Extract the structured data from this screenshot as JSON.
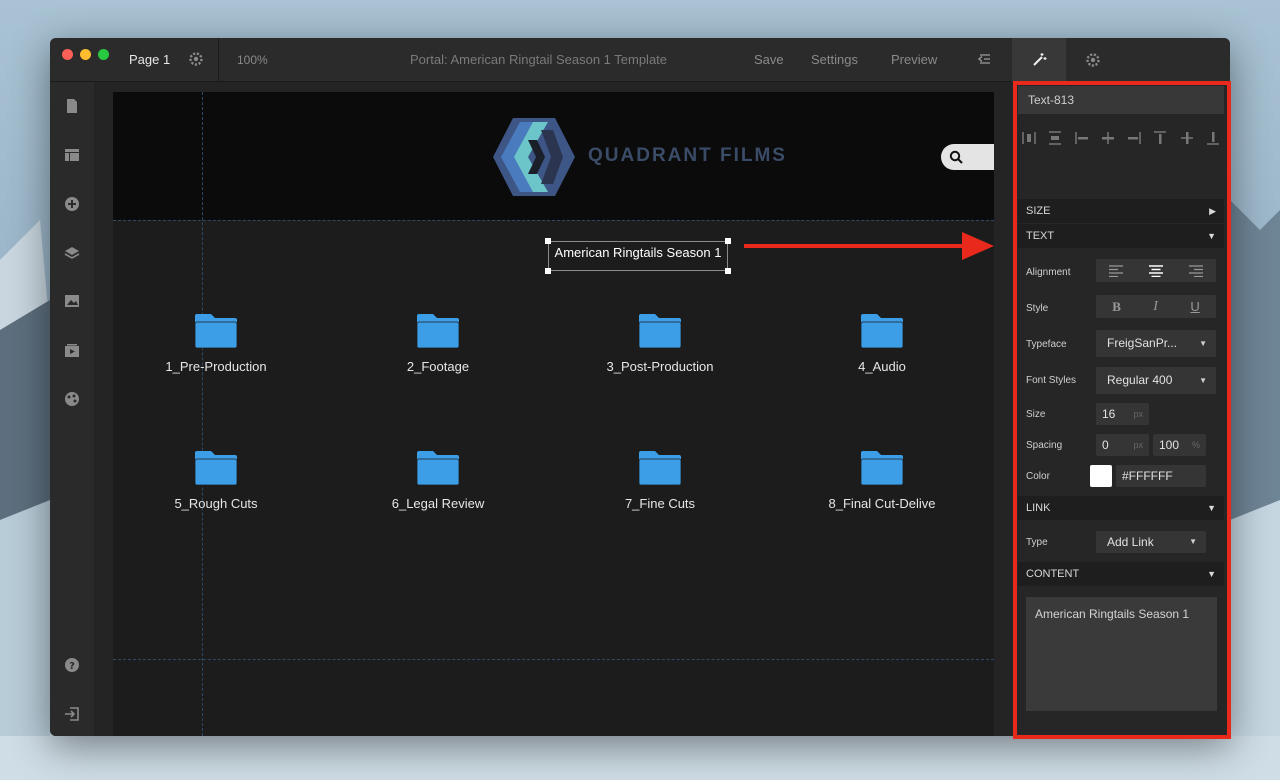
{
  "window": {
    "page_label": "Page 1",
    "zoom": "100%",
    "title": "Portal: American Ringtail Season 1 Template",
    "menu": {
      "save": "Save",
      "settings": "Settings",
      "preview": "Preview"
    }
  },
  "canvas": {
    "brand": "QUADRANT FILMS",
    "selected_text": "American Ringtails Season 1",
    "folders": [
      {
        "label": "1_Pre-Production"
      },
      {
        "label": "2_Footage"
      },
      {
        "label": "3_Post-Production"
      },
      {
        "label": "4_Audio"
      },
      {
        "label": "5_Rough Cuts"
      },
      {
        "label": "6_Legal Review"
      },
      {
        "label": "7_Fine Cuts"
      },
      {
        "label": "8_Final Cut-Delive"
      }
    ],
    "folder_color": "#3d9ee8"
  },
  "panel": {
    "element_name": "Text-813",
    "sections": {
      "size": "SIZE",
      "text": "TEXT",
      "link": "LINK",
      "content": "CONTENT"
    },
    "labels": {
      "alignment": "Alignment",
      "style": "Style",
      "typeface": "Typeface",
      "font_styles": "Font Styles",
      "size": "Size",
      "spacing": "Spacing",
      "color": "Color",
      "type": "Type"
    },
    "values": {
      "typeface": "FreigSanPr...",
      "font_style": "Regular 400",
      "size": "16",
      "size_unit": "px",
      "spacing": "0",
      "spacing_unit": "px",
      "spacing_pct": "100",
      "pct_unit": "%",
      "color": "#FFFFFF",
      "link_type": "Add Link",
      "content": "American Ringtails Season 1"
    },
    "style_buttons": {
      "bold": "B",
      "italic": "I",
      "underline": "U"
    }
  },
  "colors": {
    "highlight": "#e8291c",
    "arrow": "#e8291c"
  }
}
